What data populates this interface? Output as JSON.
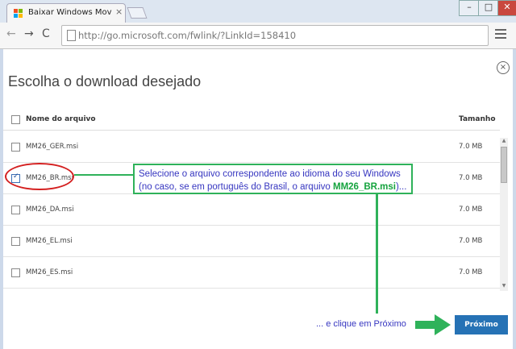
{
  "browser": {
    "tab_title": "Baixar Windows Movie M",
    "tab_close": "×",
    "url": "http://go.microsoft.com/fwlink/?LinkId=158410",
    "win_min": "–",
    "win_max": "□",
    "win_close": "✕",
    "back_icon": "←",
    "forward_icon": "→",
    "reload_icon": "C"
  },
  "dialog": {
    "close_icon": "×",
    "heading": "Escolha o download desejado",
    "col_name": "Nome do arquivo",
    "col_size": "Tamanho",
    "files": [
      {
        "name": "MM26_GER.msi",
        "size": "7.0 MB",
        "checked": false
      },
      {
        "name": "MM26_BR.msi",
        "size": "7.0 MB",
        "checked": true
      },
      {
        "name": "MM26_DA.msi",
        "size": "7.0 MB",
        "checked": false
      },
      {
        "name": "MM26_EL.msi",
        "size": "7.0 MB",
        "checked": false
      },
      {
        "name": "MM26_ES.msi",
        "size": "7.0 MB",
        "checked": false
      }
    ],
    "next_label": "Próximo"
  },
  "annotation": {
    "line1": "Selecione o arquivo correspondente ao idioma do seu Windows",
    "line2_a": "(no caso, se em português do Brasil, o arquivo ",
    "line2_b": "MM26_BR.msi",
    "line2_c": ")...",
    "bottom_text": "... e clique em Próximo"
  },
  "colors": {
    "accent_button": "#2672b5",
    "annotation_green": "#2fb25a",
    "annotation_red": "#d42020",
    "annotation_text": "#3636c0"
  }
}
